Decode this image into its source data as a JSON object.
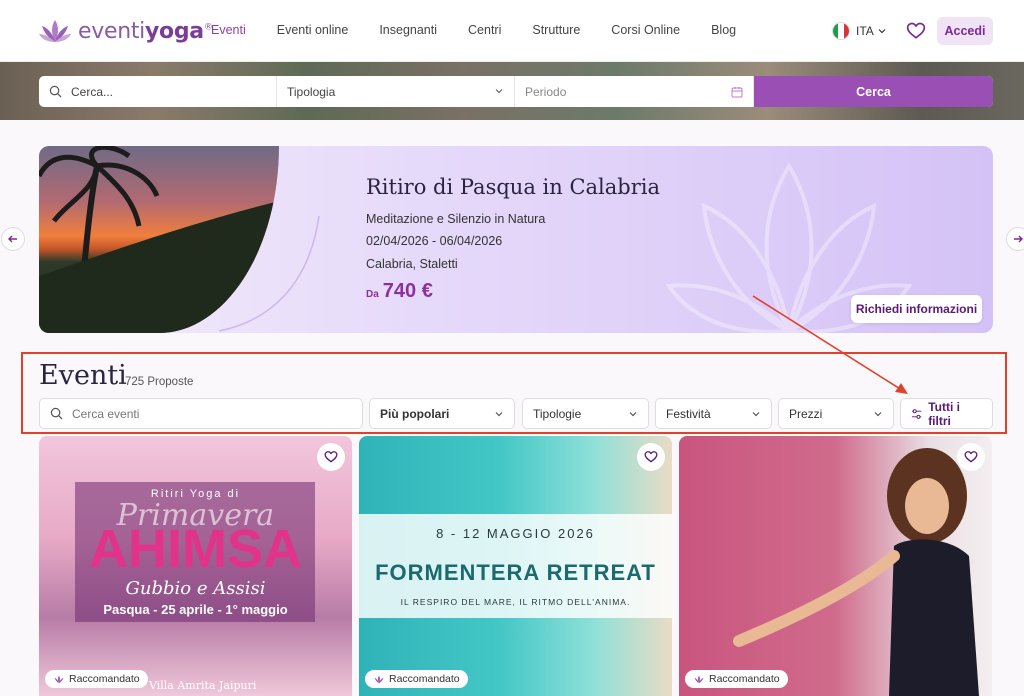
{
  "header": {
    "logo_prefix": "eventi",
    "logo_bold": "yoga",
    "logo_mark": "®",
    "nav": [
      "Eventi",
      "Eventi online",
      "Insegnanti",
      "Centri",
      "Strutture",
      "Corsi Online",
      "Blog"
    ],
    "active_nav": "Eventi",
    "language": "ITA",
    "login_label": "Accedi"
  },
  "search": {
    "query_placeholder": "Cerca...",
    "type_label": "Tipologia",
    "period_placeholder": "Periodo",
    "submit_label": "Cerca"
  },
  "banner": {
    "title": "Ritiro di Pasqua in Calabria",
    "subtitle": "Meditazione e Silenzio in Natura",
    "dates": "02/04/2026 - 06/04/2026",
    "location": "Calabria, Staletti",
    "price_prefix": "Da",
    "price": "740 €",
    "cta": "Richiedi informazioni"
  },
  "events": {
    "title": "Eventi",
    "count": "725 Proposte",
    "search_placeholder": "Cerca eventi",
    "sort_label": "Più popolari",
    "filters": [
      "Tipologie",
      "Festività",
      "Prezzi"
    ],
    "all_filters_label": "Tutti i filtri"
  },
  "cards": [
    {
      "badge": "Raccomandato",
      "top_text": "Ritiri Yoga di",
      "script_text": "Primavera",
      "main_text": "AHIMSA",
      "sub_text": "Gubbio e Assisi",
      "date_text": "Pasqua - 25 aprile - 1° maggio",
      "footer_text": "Villa Amrita Jaipuri"
    },
    {
      "badge": "Raccomandato",
      "date_text": "8 - 12 MAGGIO 2026",
      "main_text": "FORMENTERA RETREAT",
      "sub_text": "IL RESPIRO DEL MARE, IL RITMO DELL'ANIMA."
    },
    {
      "badge": "Raccomandato"
    }
  ],
  "colors": {
    "brand": "#9a4fb5",
    "accent_dark": "#7b2b95",
    "highlight_box": "#e0412a"
  }
}
